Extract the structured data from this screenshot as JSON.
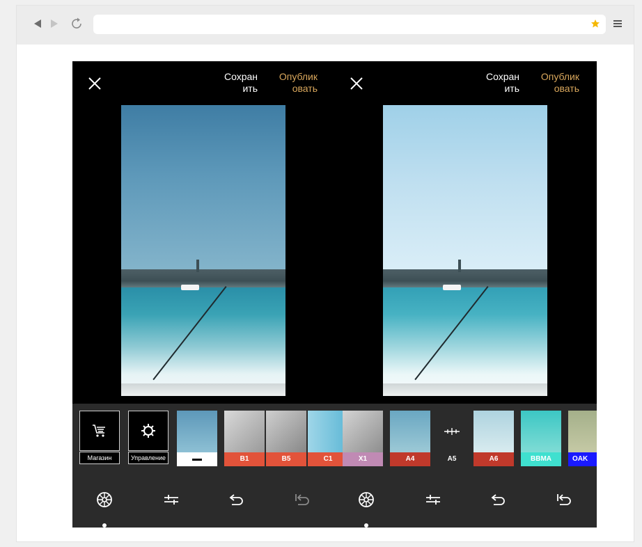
{
  "browser": {
    "back_icon": "back-arrow-icon",
    "forward_icon": "forward-arrow-icon",
    "reload_icon": "reload-icon",
    "url": "",
    "bookmark_icon": "star-icon",
    "bookmark_color": "#f5b800",
    "menu_icon": "hamburger-menu-icon"
  },
  "editor": {
    "left": {
      "close_icon": "close-icon",
      "save_line1": "Сохран",
      "save_line2": "ить",
      "publish_line1": "Опублик",
      "publish_line2": "овать"
    },
    "right": {
      "close_icon": "close-icon",
      "save_line1": "Сохран",
      "save_line2": "ить",
      "publish_line1": "Опублик",
      "publish_line2": "овать"
    },
    "accent_color": "#d9a75c"
  },
  "tools": [
    {
      "label": "Магазин",
      "icon": "cart-icon"
    },
    {
      "label": "Управление",
      "icon": "gear-icon"
    }
  ],
  "filters": [
    {
      "label": "",
      "band_color": "#ffffff",
      "thumb": "original"
    },
    {
      "label": "B1",
      "band_color": "#e2533a"
    },
    {
      "label": "B5",
      "band_color": "#e2533a"
    },
    {
      "label": "C1",
      "band_color": "#e2533a"
    },
    {
      "label": "X1",
      "band_color": "#c08ab4"
    },
    {
      "label": "A4",
      "band_color": "#c0392b"
    },
    {
      "label": "A5",
      "band_color": "#000000"
    },
    {
      "label": "A6",
      "band_color": "#c0392b"
    },
    {
      "label": "BBMA",
      "band_color": "#3fe0cf"
    },
    {
      "label": "OAK",
      "band_color": "#1a1aff"
    }
  ],
  "bottom_bar": [
    {
      "icon": "filters-wheel-icon",
      "active": true
    },
    {
      "icon": "adjust-sliders-icon",
      "active": false
    },
    {
      "icon": "undo-icon",
      "active": false
    },
    {
      "icon": "revert-icon",
      "active": false
    },
    {
      "icon": "filters-wheel-icon",
      "active": true
    },
    {
      "icon": "adjust-sliders-icon",
      "active": false
    },
    {
      "icon": "undo-icon",
      "active": false
    },
    {
      "icon": "revert-icon",
      "active": false
    }
  ]
}
